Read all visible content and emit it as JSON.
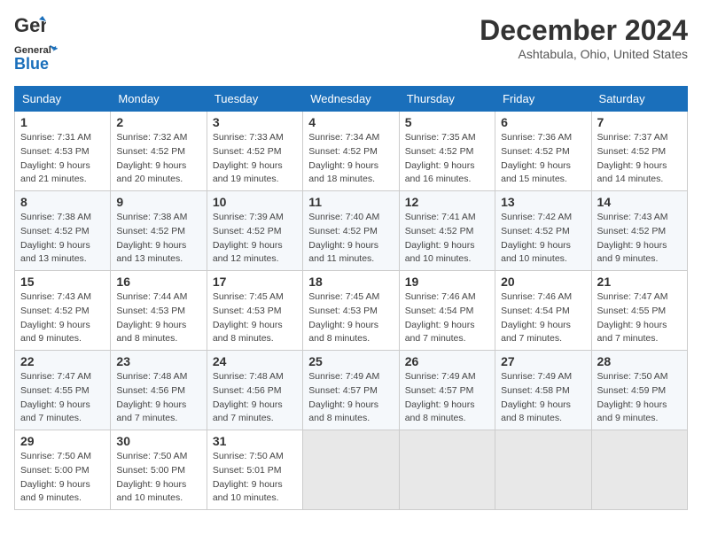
{
  "header": {
    "logo_line1": "General",
    "logo_line2": "Blue",
    "month": "December 2024",
    "location": "Ashtabula, Ohio, United States"
  },
  "weekdays": [
    "Sunday",
    "Monday",
    "Tuesday",
    "Wednesday",
    "Thursday",
    "Friday",
    "Saturday"
  ],
  "weeks": [
    [
      {
        "day": 1,
        "info": "Sunrise: 7:31 AM\nSunset: 4:53 PM\nDaylight: 9 hours\nand 21 minutes."
      },
      {
        "day": 2,
        "info": "Sunrise: 7:32 AM\nSunset: 4:52 PM\nDaylight: 9 hours\nand 20 minutes."
      },
      {
        "day": 3,
        "info": "Sunrise: 7:33 AM\nSunset: 4:52 PM\nDaylight: 9 hours\nand 19 minutes."
      },
      {
        "day": 4,
        "info": "Sunrise: 7:34 AM\nSunset: 4:52 PM\nDaylight: 9 hours\nand 18 minutes."
      },
      {
        "day": 5,
        "info": "Sunrise: 7:35 AM\nSunset: 4:52 PM\nDaylight: 9 hours\nand 16 minutes."
      },
      {
        "day": 6,
        "info": "Sunrise: 7:36 AM\nSunset: 4:52 PM\nDaylight: 9 hours\nand 15 minutes."
      },
      {
        "day": 7,
        "info": "Sunrise: 7:37 AM\nSunset: 4:52 PM\nDaylight: 9 hours\nand 14 minutes."
      }
    ],
    [
      {
        "day": 8,
        "info": "Sunrise: 7:38 AM\nSunset: 4:52 PM\nDaylight: 9 hours\nand 13 minutes."
      },
      {
        "day": 9,
        "info": "Sunrise: 7:38 AM\nSunset: 4:52 PM\nDaylight: 9 hours\nand 13 minutes."
      },
      {
        "day": 10,
        "info": "Sunrise: 7:39 AM\nSunset: 4:52 PM\nDaylight: 9 hours\nand 12 minutes."
      },
      {
        "day": 11,
        "info": "Sunrise: 7:40 AM\nSunset: 4:52 PM\nDaylight: 9 hours\nand 11 minutes."
      },
      {
        "day": 12,
        "info": "Sunrise: 7:41 AM\nSunset: 4:52 PM\nDaylight: 9 hours\nand 10 minutes."
      },
      {
        "day": 13,
        "info": "Sunrise: 7:42 AM\nSunset: 4:52 PM\nDaylight: 9 hours\nand 10 minutes."
      },
      {
        "day": 14,
        "info": "Sunrise: 7:43 AM\nSunset: 4:52 PM\nDaylight: 9 hours\nand 9 minutes."
      }
    ],
    [
      {
        "day": 15,
        "info": "Sunrise: 7:43 AM\nSunset: 4:52 PM\nDaylight: 9 hours\nand 9 minutes."
      },
      {
        "day": 16,
        "info": "Sunrise: 7:44 AM\nSunset: 4:53 PM\nDaylight: 9 hours\nand 8 minutes."
      },
      {
        "day": 17,
        "info": "Sunrise: 7:45 AM\nSunset: 4:53 PM\nDaylight: 9 hours\nand 8 minutes."
      },
      {
        "day": 18,
        "info": "Sunrise: 7:45 AM\nSunset: 4:53 PM\nDaylight: 9 hours\nand 8 minutes."
      },
      {
        "day": 19,
        "info": "Sunrise: 7:46 AM\nSunset: 4:54 PM\nDaylight: 9 hours\nand 7 minutes."
      },
      {
        "day": 20,
        "info": "Sunrise: 7:46 AM\nSunset: 4:54 PM\nDaylight: 9 hours\nand 7 minutes."
      },
      {
        "day": 21,
        "info": "Sunrise: 7:47 AM\nSunset: 4:55 PM\nDaylight: 9 hours\nand 7 minutes."
      }
    ],
    [
      {
        "day": 22,
        "info": "Sunrise: 7:47 AM\nSunset: 4:55 PM\nDaylight: 9 hours\nand 7 minutes."
      },
      {
        "day": 23,
        "info": "Sunrise: 7:48 AM\nSunset: 4:56 PM\nDaylight: 9 hours\nand 7 minutes."
      },
      {
        "day": 24,
        "info": "Sunrise: 7:48 AM\nSunset: 4:56 PM\nDaylight: 9 hours\nand 7 minutes."
      },
      {
        "day": 25,
        "info": "Sunrise: 7:49 AM\nSunset: 4:57 PM\nDaylight: 9 hours\nand 8 minutes."
      },
      {
        "day": 26,
        "info": "Sunrise: 7:49 AM\nSunset: 4:57 PM\nDaylight: 9 hours\nand 8 minutes."
      },
      {
        "day": 27,
        "info": "Sunrise: 7:49 AM\nSunset: 4:58 PM\nDaylight: 9 hours\nand 8 minutes."
      },
      {
        "day": 28,
        "info": "Sunrise: 7:50 AM\nSunset: 4:59 PM\nDaylight: 9 hours\nand 9 minutes."
      }
    ],
    [
      {
        "day": 29,
        "info": "Sunrise: 7:50 AM\nSunset: 5:00 PM\nDaylight: 9 hours\nand 9 minutes."
      },
      {
        "day": 30,
        "info": "Sunrise: 7:50 AM\nSunset: 5:00 PM\nDaylight: 9 hours\nand 10 minutes."
      },
      {
        "day": 31,
        "info": "Sunrise: 7:50 AM\nSunset: 5:01 PM\nDaylight: 9 hours\nand 10 minutes."
      },
      null,
      null,
      null,
      null
    ]
  ]
}
